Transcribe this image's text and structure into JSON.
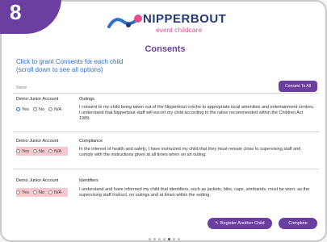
{
  "step_badge": "8",
  "brand": {
    "name": "NIPPERBOUT",
    "subtitle": "event childcare"
  },
  "title": "Consents",
  "intro": {
    "line1": "Click to grant Consents for each child",
    "line2": "(scroll down to see all options)"
  },
  "column_header": "Name",
  "consent_all_button": "Consent To All",
  "rows": [
    {
      "child": "Demo Junior Account",
      "category": "Outings",
      "text": "I consent to my child being taken out of the Nipperbout crèche to appropriate local amenities and entertainment centres.  I understand that Nipperbout staff will escort my child according to the ratios recommended within the Children Act 1989.",
      "options": [
        "Yes",
        "No",
        "N/A"
      ],
      "selected": "Yes"
    },
    {
      "child": "Demo Junior Account",
      "category": "Compliance",
      "text": "In the interest of health and safety, I have instructed my child that they must remain close to supervising staff and comply with the instructions given at all times when on an outing.",
      "options": [
        "Yes",
        "No",
        "N/A"
      ],
      "selected": ""
    },
    {
      "child": "Demo Junior Account",
      "category": "Identifiers",
      "text": "I understand and have informed my child that identifiers, such as jackets, bibs, caps, armbands, must be worn, as the supervising staff instruct, on outings and at times within the setting.",
      "options": [
        "Yes",
        "No",
        "N/A"
      ],
      "selected": ""
    }
  ],
  "buttons": {
    "register": "↖ Register Another Child",
    "complete": "Complete"
  },
  "pagination": {
    "total": 7,
    "active": 4
  },
  "colors": {
    "brand_purple": "#6b3fa0",
    "link_blue": "#2f6fc7",
    "unselected_row": "#f6c8ce"
  }
}
